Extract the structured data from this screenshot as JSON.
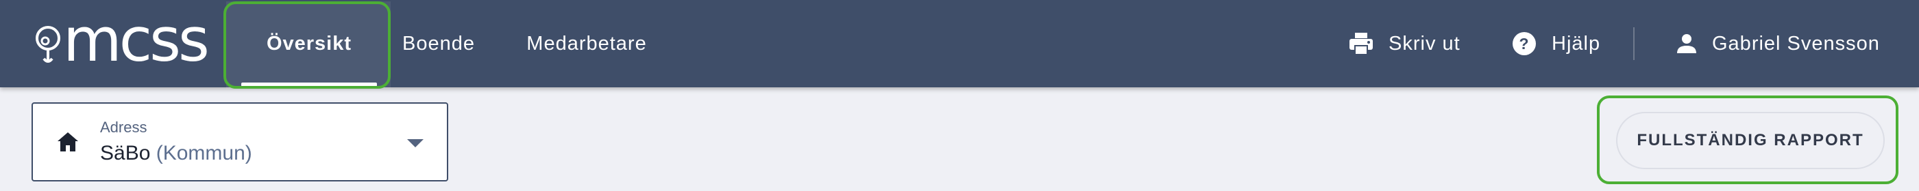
{
  "header": {
    "logo_text": "mcss",
    "tabs": [
      {
        "label": "Översikt",
        "active": true
      },
      {
        "label": "Boende",
        "active": false
      },
      {
        "label": "Medarbetare",
        "active": false
      }
    ],
    "print_label": "Skriv ut",
    "help_label": "Hjälp",
    "user_name": "Gabriel Svensson"
  },
  "address_select": {
    "label": "Adress",
    "value": "SäBo",
    "suffix": "(Kommun)"
  },
  "report_button": {
    "label": "FULLSTÄNDIG RAPPORT"
  },
  "colors": {
    "header_bg": "#3f4e69",
    "page_bg": "#eff0f5",
    "highlight": "#4caf35"
  },
  "icons": [
    "logo-pin-icon",
    "printer-icon",
    "help-icon",
    "person-icon",
    "home-icon",
    "caret-down-icon"
  ]
}
